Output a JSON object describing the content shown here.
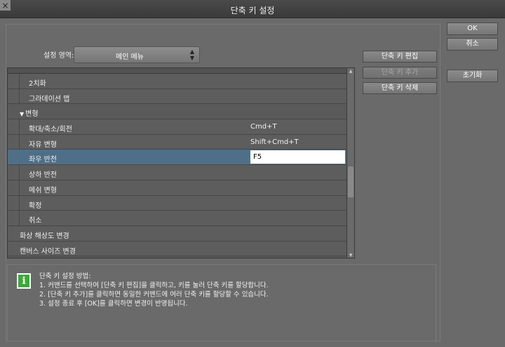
{
  "window": {
    "title": "단축 키 설정",
    "close_glyph": "×"
  },
  "area": {
    "label": "설정 영역:",
    "selected": "메인 메뉴"
  },
  "list": {
    "rows": [
      {
        "name": "2치화",
        "key": "",
        "indent": 2,
        "type": "item"
      },
      {
        "name": "그라데이션 맵",
        "key": "",
        "indent": 2,
        "type": "item"
      },
      {
        "name": "변형",
        "key": "",
        "indent": 1,
        "type": "category"
      },
      {
        "name": "확대/축소/회전",
        "key": "Cmd+T",
        "indent": 2,
        "type": "item"
      },
      {
        "name": "자유 변형",
        "key": "Shift+Cmd+T",
        "indent": 2,
        "type": "item"
      },
      {
        "name": "좌우 반전",
        "key": "F5",
        "indent": 2,
        "type": "selected"
      },
      {
        "name": "상하 반전",
        "key": "",
        "indent": 2,
        "type": "item"
      },
      {
        "name": "메쉬 변형",
        "key": "",
        "indent": 2,
        "type": "item"
      },
      {
        "name": "확정",
        "key": "",
        "indent": 2,
        "type": "item"
      },
      {
        "name": "취소",
        "key": "",
        "indent": 2,
        "type": "item"
      },
      {
        "name": "화상 해상도 변경",
        "key": "",
        "indent": 1,
        "type": "item"
      },
      {
        "name": "캔버스 사이즈 변경",
        "key": "",
        "indent": 1,
        "type": "item"
      }
    ]
  },
  "side_buttons": {
    "edit": "단축 키 편집",
    "add": "단축 키 추가",
    "delete": "단축 키 삭제"
  },
  "dialog_buttons": {
    "ok": "OK",
    "cancel": "취소",
    "reset": "초기화"
  },
  "info": {
    "icon": "i",
    "lines": [
      "단축 키 설정 방법:",
      "1. 커맨드를 선택하여 [단축 키 편집]을 클릭하고, 키를 눌러 단축 키를 할당합니다.",
      "2. [단축 키 추가]를 클릭하면 동일한 커맨드에 여러 단축 키를 할당할 수 있습니다.",
      "3. 설정 종료 후 [OK]를 클릭하면 변경이 반영됩니다."
    ]
  }
}
